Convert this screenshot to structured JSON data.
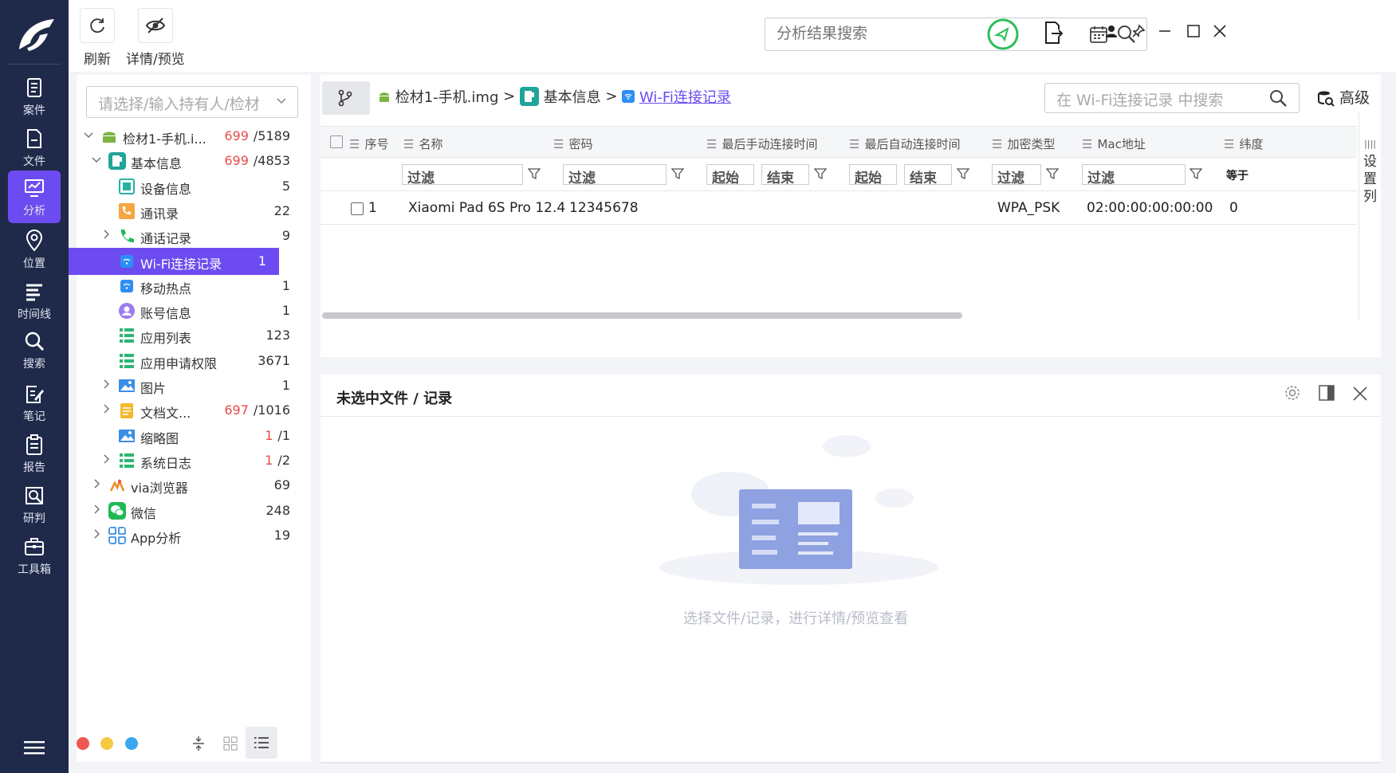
{
  "leftnav": {
    "items": [
      {
        "label": "案件",
        "icon": "case-icon"
      },
      {
        "label": "文件",
        "icon": "file-icon"
      },
      {
        "label": "分析",
        "icon": "analysis-icon",
        "active": true
      },
      {
        "label": "位置",
        "icon": "location-icon"
      },
      {
        "label": "时间线",
        "icon": "timeline-icon"
      },
      {
        "label": "搜索",
        "icon": "search-icon"
      },
      {
        "label": "笔记",
        "icon": "note-icon"
      },
      {
        "label": "报告",
        "icon": "report-icon"
      },
      {
        "label": "研判",
        "icon": "judgement-icon"
      },
      {
        "label": "工具箱",
        "icon": "toolbox-icon"
      }
    ]
  },
  "toolbar": {
    "refresh_label": "刷新",
    "detail_label": "详情/预览",
    "search_placeholder": "分析结果搜索"
  },
  "tree": {
    "select_placeholder": "请选择/输入持有人/检材",
    "rows": [
      {
        "label": "检材1-手机.i...",
        "count_red": "699",
        "count": "/5189"
      },
      {
        "label": "基本信息",
        "count_red": "699",
        "count": "/4853"
      },
      {
        "label": "设备信息",
        "count_red": "",
        "count": "5"
      },
      {
        "label": "通讯录",
        "count_red": "",
        "count": "22"
      },
      {
        "label": "通话记录",
        "count_red": "",
        "count": "9"
      },
      {
        "label": "Wi-Fi连接记录",
        "count_red": "",
        "count": "1"
      },
      {
        "label": "移动热点",
        "count_red": "",
        "count": "1"
      },
      {
        "label": "账号信息",
        "count_red": "",
        "count": "1"
      },
      {
        "label": "应用列表",
        "count_red": "",
        "count": "123"
      },
      {
        "label": "应用申请权限",
        "count_red": "",
        "count": "3671"
      },
      {
        "label": "图片",
        "count_red": "",
        "count": "1"
      },
      {
        "label": "文档文...",
        "count_red": "697",
        "count": "/1016"
      },
      {
        "label": "缩略图",
        "count_red": "1",
        "count": "/1"
      },
      {
        "label": "系统日志",
        "count_red": "1",
        "count": "/2"
      },
      {
        "label": "via浏览器",
        "count_red": "",
        "count": "69"
      },
      {
        "label": "微信",
        "count_red": "",
        "count": "248"
      },
      {
        "label": "App分析",
        "count_red": "",
        "count": "19"
      }
    ]
  },
  "breadcrumb": {
    "item1": "检材1-手机.img",
    "item2": "基本信息",
    "item3": "Wi-Fi连接记录",
    "sep": ">"
  },
  "table": {
    "search_placeholder": "在 Wi-Fi连接记录 中搜索",
    "advanced_label": "高级",
    "columns": [
      "序号",
      "名称",
      "密码",
      "最后手动连接时间",
      "最后自动连接时间",
      "加密类型",
      "Mac地址",
      "纬度"
    ],
    "filters": {
      "filter": "过滤",
      "start": "起始",
      "end": "结束",
      "equals": "等于"
    },
    "rows": [
      {
        "index": "1",
        "name": "Xiaomi Pad 6S Pro 12.4",
        "password": "12345678",
        "manual_time": "",
        "auto_time": "",
        "encryption": "WPA_PSK",
        "mac": "02:00:00:00:00:00",
        "lat": "0"
      }
    ],
    "set_columns_label": "设置列"
  },
  "preview": {
    "title": "未选中文件 / 记录",
    "empty_text": "选择文件/记录，进行详情/预览查看"
  },
  "colors": {
    "nav_bg": "#1f2a4a",
    "accent": "#6c4cf0",
    "red_count": "#e84a4a",
    "status_green": "#2dbd5a"
  }
}
